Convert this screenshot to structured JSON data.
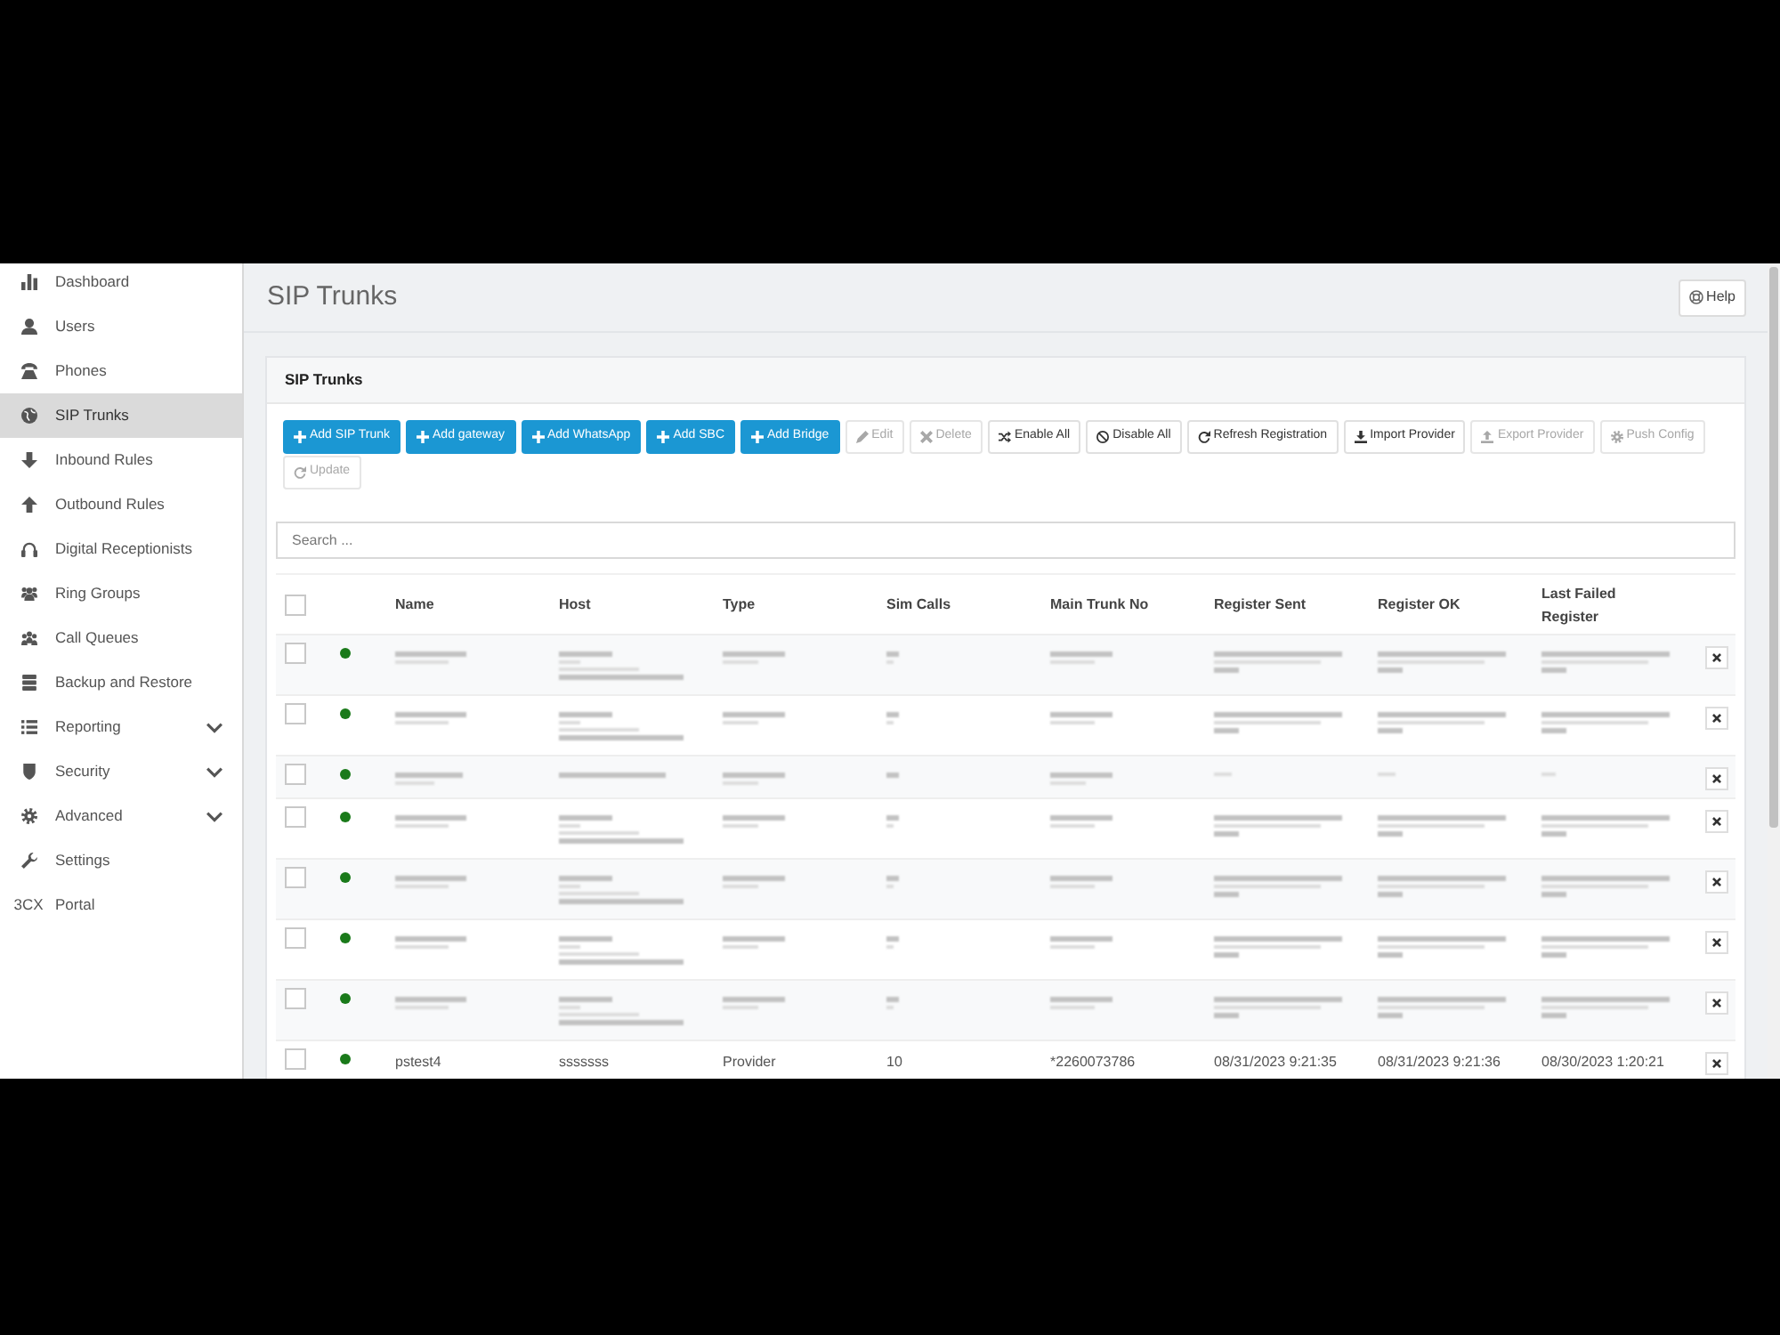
{
  "sidebar": {
    "items": [
      {
        "label": "Dashboard",
        "selected": false,
        "expandable": false
      },
      {
        "label": "Users",
        "selected": false,
        "expandable": false
      },
      {
        "label": "Phones",
        "selected": false,
        "expandable": false
      },
      {
        "label": "SIP Trunks",
        "selected": true,
        "expandable": false
      },
      {
        "label": "Inbound Rules",
        "selected": false,
        "expandable": false
      },
      {
        "label": "Outbound Rules",
        "selected": false,
        "expandable": false
      },
      {
        "label": "Digital Receptionists",
        "selected": false,
        "expandable": false
      },
      {
        "label": "Ring Groups",
        "selected": false,
        "expandable": false
      },
      {
        "label": "Call Queues",
        "selected": false,
        "expandable": false
      },
      {
        "label": "Backup and Restore",
        "selected": false,
        "expandable": false
      },
      {
        "label": "Reporting",
        "selected": false,
        "expandable": true
      },
      {
        "label": "Security",
        "selected": false,
        "expandable": true
      },
      {
        "label": "Advanced",
        "selected": false,
        "expandable": true
      },
      {
        "label": "Settings",
        "selected": false,
        "expandable": false
      },
      {
        "label": "Portal",
        "selected": false,
        "expandable": false,
        "icon_text": "3CX"
      }
    ]
  },
  "header": {
    "title": "SIP Trunks",
    "help_button": "Help"
  },
  "panel": {
    "title": "SIP Trunks",
    "toolbar_rows": [
      [
        {
          "label": "Add SIP Trunk",
          "kind": "primary",
          "disabled": false
        },
        {
          "label": "Add gateway",
          "kind": "primary",
          "disabled": false
        },
        {
          "label": "Add WhatsApp",
          "kind": "primary",
          "disabled": false
        },
        {
          "label": "Add SBC",
          "kind": "primary",
          "disabled": false
        },
        {
          "label": "Add Bridge",
          "kind": "primary",
          "disabled": false
        },
        {
          "label": "Edit",
          "kind": "default",
          "disabled": true
        },
        {
          "label": "Delete",
          "kind": "default",
          "disabled": true
        },
        {
          "label": "Enable All",
          "kind": "default",
          "disabled": false
        },
        {
          "label": "Disable All",
          "kind": "default",
          "disabled": false
        },
        {
          "label": "Refresh Registration",
          "kind": "default",
          "disabled": false
        },
        {
          "label": "Import Provider",
          "kind": "default",
          "disabled": false
        },
        {
          "label": "Export Provider",
          "kind": "default",
          "disabled": true
        },
        {
          "label": "Push Config",
          "kind": "default",
          "disabled": true
        }
      ],
      [
        {
          "label": "Update",
          "kind": "default",
          "disabled": true
        }
      ]
    ],
    "search": {
      "placeholder": "Search ..."
    },
    "table": {
      "select_all": {
        "checked": false
      },
      "columns": [
        "Name",
        "Host",
        "Type",
        "Sim Calls",
        "Main Trunk No",
        "Register Sent",
        "Register OK",
        "Last Failed Register"
      ],
      "rows": [
        {
          "kind": "blurred",
          "checked": false,
          "color": "#1a7a1a"
        },
        {
          "kind": "blurred",
          "checked": false,
          "color": "#1a7a1a"
        },
        {
          "kind": "compact",
          "checked": false,
          "color": "#1a7a1a"
        },
        {
          "kind": "blurred",
          "checked": false,
          "color": "#1a7a1a"
        },
        {
          "kind": "blurred",
          "checked": false,
          "color": "#1a7a1a"
        },
        {
          "kind": "blurred",
          "checked": false,
          "color": "#1a7a1a"
        },
        {
          "kind": "blurred",
          "checked": false,
          "color": "#1a7a1a"
        },
        {
          "kind": "text",
          "checked": false,
          "color": "#1a7a1a",
          "cells": [
            "pstest4",
            "sssssss",
            "Provider",
            "10",
            "*2260073786",
            "08/31/2023 9:21:35",
            "08/31/2023 9:21:36",
            "08/30/2023 1:20:21"
          ]
        }
      ]
    }
  }
}
